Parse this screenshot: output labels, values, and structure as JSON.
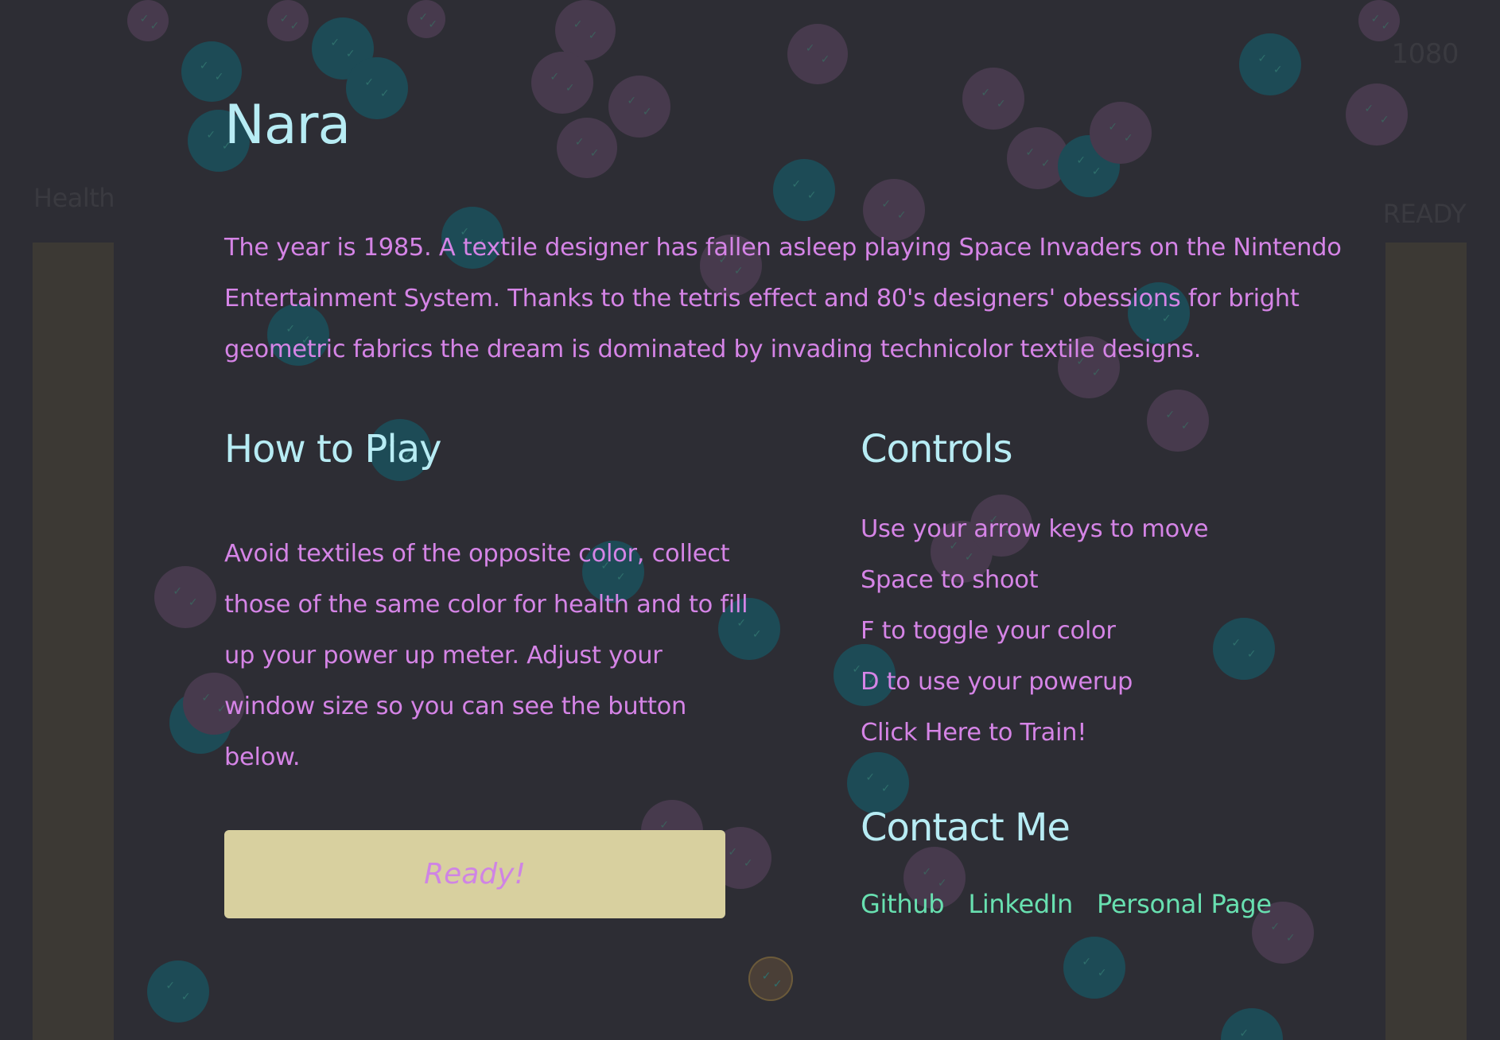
{
  "game": {
    "title": "Nara",
    "intro": "The year is 1985. A textile designer has fallen asleep playing Space Invaders on the Nintendo Entertainment System. Thanks to the tetris effect and 80's designers' obessions for bright geometric fabrics the dream is dominated by invading technicolor textile designs."
  },
  "hud": {
    "health_label": "Health",
    "score": "1080",
    "power_label": "READY"
  },
  "how_to_play": {
    "heading": "How to Play",
    "text": "Avoid textiles of the opposite color, collect those of the same color for health and to fill up your power up meter. Adjust your window size so you can see the button below.",
    "ready_button": "Ready!"
  },
  "controls": {
    "heading": "Controls",
    "items": [
      "Use your arrow keys to move",
      "Space to shoot",
      "F to toggle your color",
      "D to use your powerup",
      "Click Here to Train!"
    ]
  },
  "contact": {
    "heading": "Contact Me",
    "links": [
      "Github",
      "LinkedIn",
      "Personal Page"
    ]
  },
  "colors": {
    "background": "#2d2d34",
    "heading": "#b7ecf4",
    "body_text": "#d584e6",
    "link": "#68e0b0",
    "button": "#d8d09f",
    "textile_teal": "#1d4b56",
    "textile_purple": "#473a4d"
  }
}
